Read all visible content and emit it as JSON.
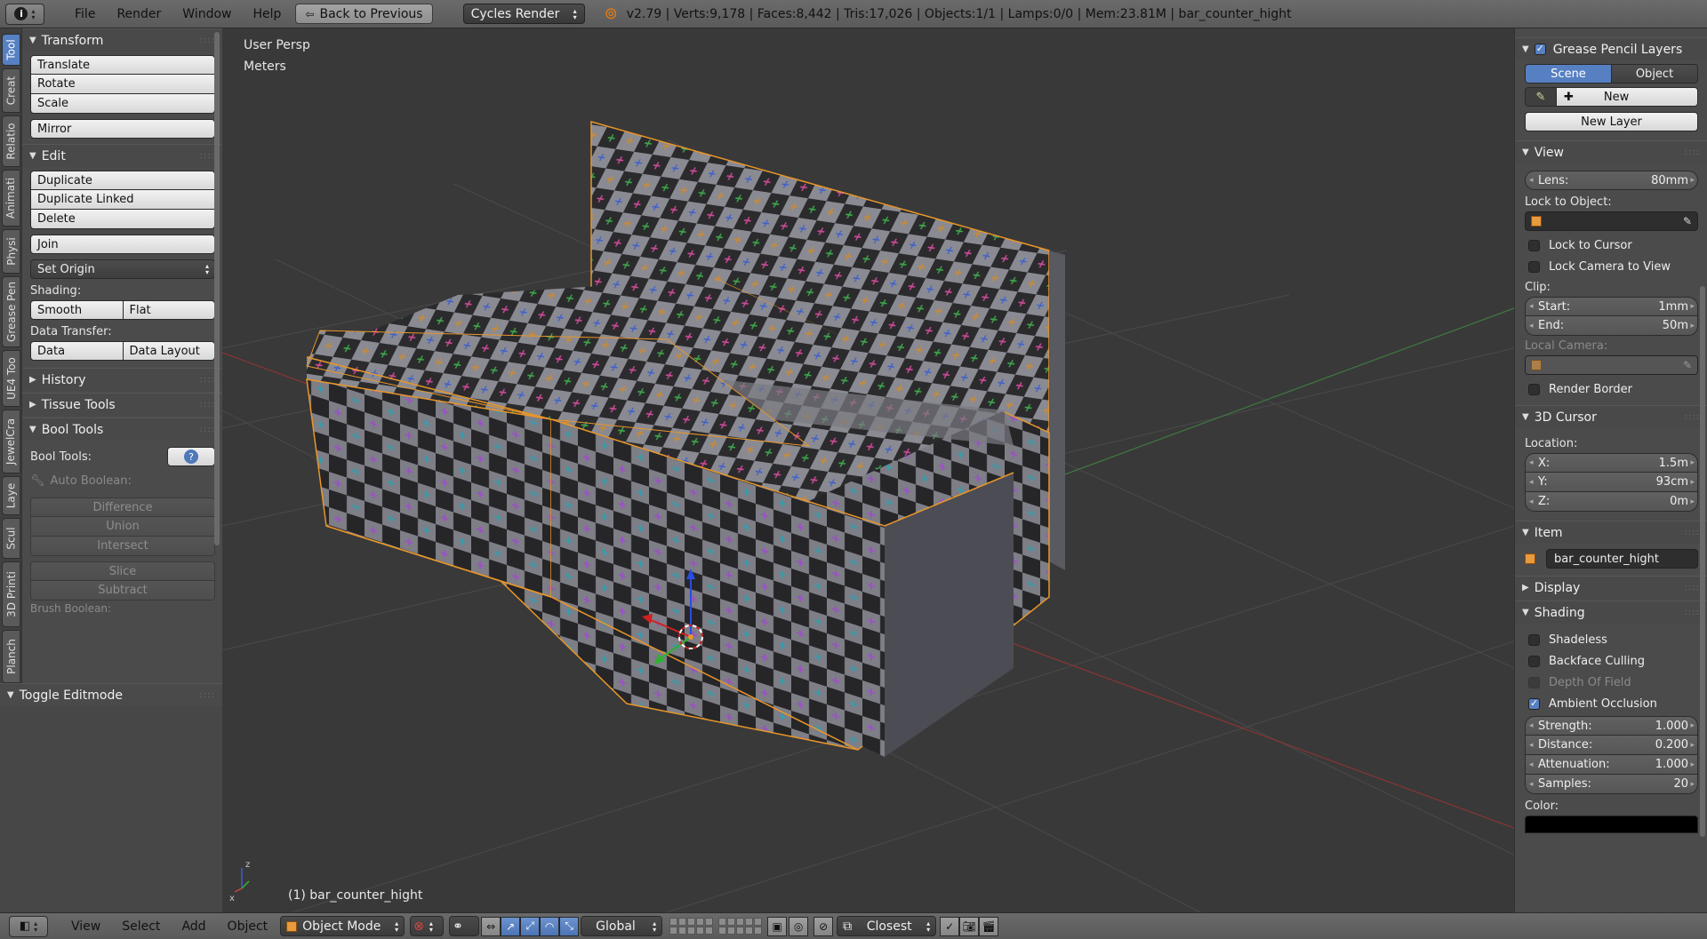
{
  "topbar": {
    "menus": [
      "File",
      "Render",
      "Window",
      "Help"
    ],
    "back_button": "Back to Previous",
    "render_engine": "Cycles Render",
    "stats": "v2.79 | Verts:9,178 | Faces:8,442 | Tris:17,026 | Objects:1/1 | Lamps:0/0 | Mem:23.81M | bar_counter_hight"
  },
  "vtabs": [
    "Tool",
    "Creat",
    "Relatio",
    "Animati",
    "Physi",
    "Grease Pen",
    "UE4 Too",
    "JewelCra",
    "Laye",
    "Scul",
    "3D Printi",
    "Planch"
  ],
  "toolshelf": {
    "transform": {
      "title": "Transform",
      "translate": "Translate",
      "rotate": "Rotate",
      "scale": "Scale",
      "mirror": "Mirror"
    },
    "edit": {
      "title": "Edit",
      "duplicate": "Duplicate",
      "duplicate_linked": "Duplicate Linked",
      "delete": "Delete",
      "join": "Join",
      "set_origin": "Set Origin",
      "shading_label": "Shading:",
      "smooth": "Smooth",
      "flat": "Flat",
      "data_transfer_label": "Data Transfer:",
      "data": "Data",
      "data_layout": "Data Layout"
    },
    "history": "History",
    "tissue": "Tissue Tools",
    "bool": {
      "title": "Bool Tools",
      "label": "Bool Tools:",
      "auto_boolean": "Auto Boolean:",
      "difference": "Difference",
      "union": "Union",
      "intersect": "Intersect",
      "slice": "Slice",
      "subtract": "Subtract",
      "brush_boolean": "Brush Boolean:"
    },
    "toggle_editmode": "Toggle Editmode"
  },
  "viewport": {
    "view_name": "User Persp",
    "units": "Meters",
    "object_label": "(1) bar_counter_hight"
  },
  "npanel": {
    "grease_pencil": {
      "title": "Grease Pencil Layers",
      "scene": "Scene",
      "object": "Object",
      "new": "New",
      "new_layer": "New Layer"
    },
    "view": {
      "title": "View",
      "lens_label": "Lens:",
      "lens_value": "80mm",
      "lock_to_object": "Lock to Object:",
      "lock_to_cursor": "Lock to Cursor",
      "lock_camera": "Lock Camera to View",
      "clip": "Clip:",
      "start_label": "Start:",
      "start_value": "1mm",
      "end_label": "End:",
      "end_value": "50m",
      "local_camera": "Local Camera:",
      "render_border": "Render Border"
    },
    "cursor": {
      "title": "3D Cursor",
      "location": "Location:",
      "x_label": "X:",
      "x_value": "1.5m",
      "y_label": "Y:",
      "y_value": "93cm",
      "z_label": "Z:",
      "z_value": "0m"
    },
    "item": {
      "title": "Item",
      "name": "bar_counter_hight"
    },
    "display": "Display",
    "shading": {
      "title": "Shading",
      "shadeless": "Shadeless",
      "backface": "Backface Culling",
      "dof": "Depth Of Field",
      "ao": "Ambient Occlusion",
      "strength_label": "Strength:",
      "strength_value": "1.000",
      "distance_label": "Distance:",
      "distance_value": "0.200",
      "attenuation_label": "Attenuation:",
      "attenuation_value": "1.000",
      "samples_label": "Samples:",
      "samples_value": "20",
      "color_label": "Color:"
    }
  },
  "bottombar": {
    "menus": [
      "View",
      "Select",
      "Add",
      "Object"
    ],
    "mode": "Object Mode",
    "orientation": "Global",
    "snap": "Closest"
  },
  "colors": {
    "accent": "#5680c2",
    "selection_outline": "#f0a030",
    "checker_dark": "#2b2b2d",
    "checker_light": "#8c8c94"
  }
}
